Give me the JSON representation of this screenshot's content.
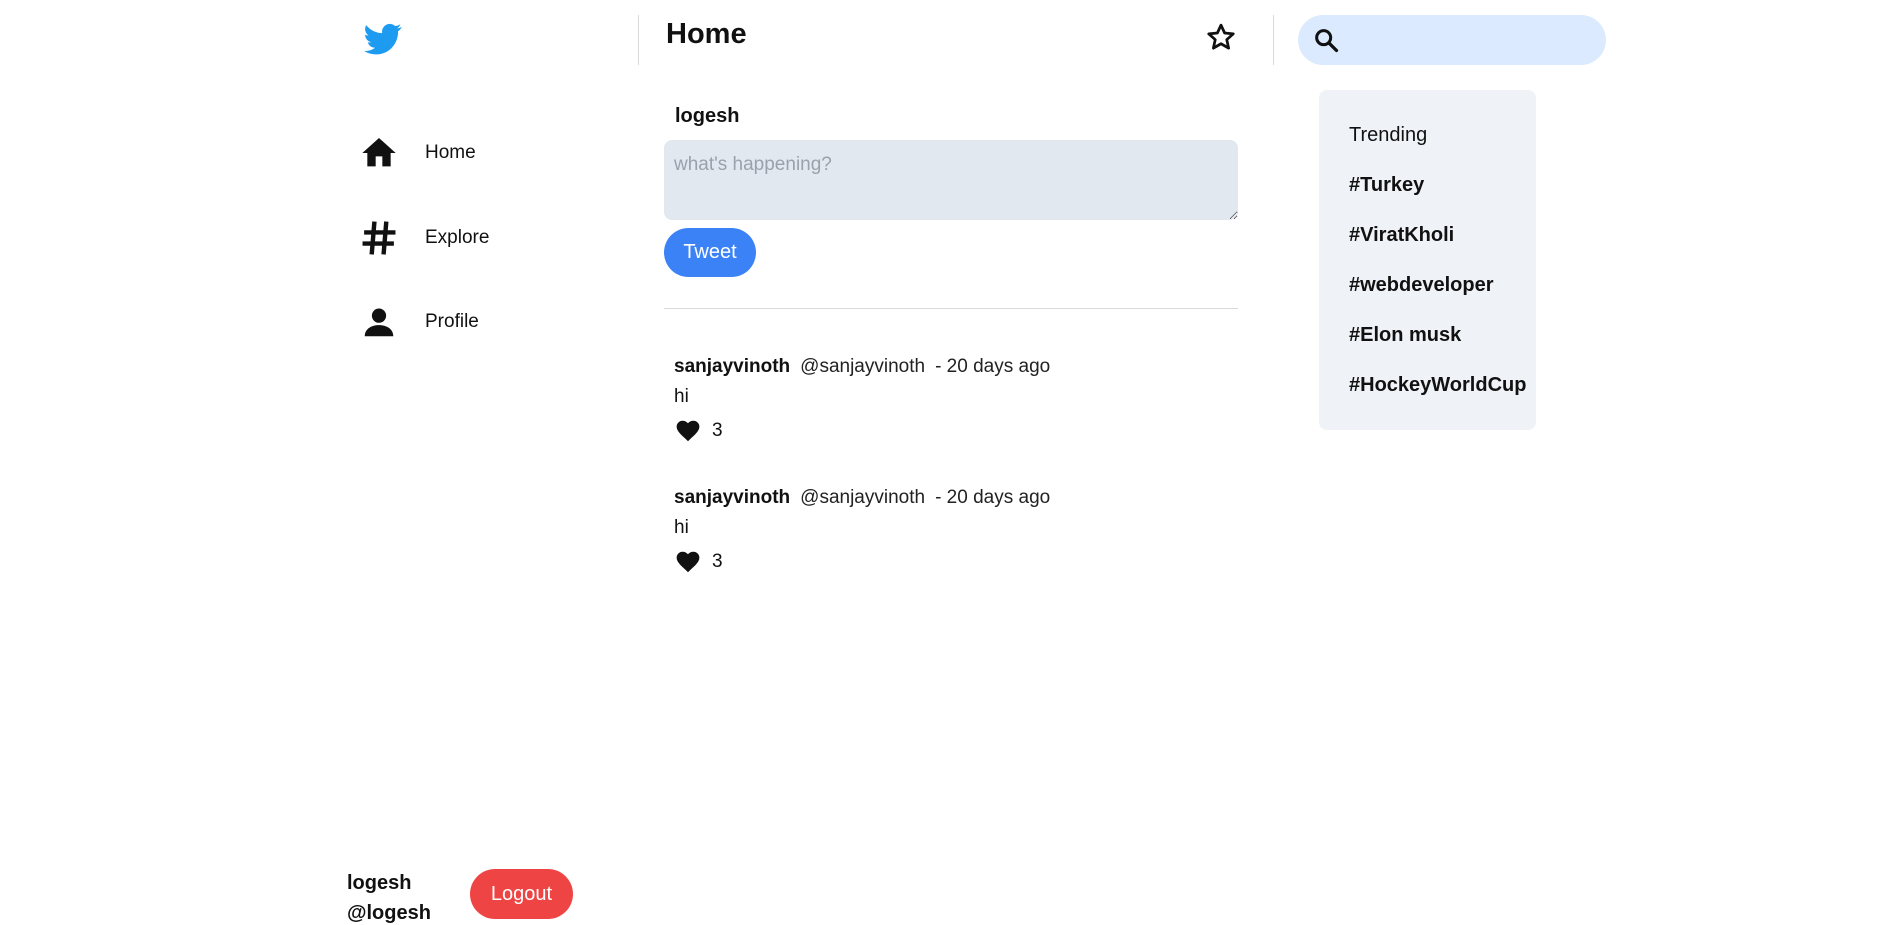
{
  "app": {
    "logo_icon": "twitter-bird-icon",
    "brand_color": "#1d9bf0"
  },
  "sidebar": {
    "items": [
      {
        "label": "Home",
        "icon": "home-icon"
      },
      {
        "label": "Explore",
        "icon": "hashtag-icon"
      },
      {
        "label": "Profile",
        "icon": "person-icon"
      }
    ],
    "user": {
      "name": "logesh",
      "handle": "@logesh"
    },
    "logout_label": "Logout"
  },
  "header": {
    "title": "Home",
    "star_icon": "star-icon"
  },
  "composer": {
    "username": "logesh",
    "placeholder": "what's happening?",
    "value": "",
    "tweet_label": "Tweet"
  },
  "feed": [
    {
      "author": "sanjayvinoth",
      "handle": "@sanjayvinoth",
      "time": "- 20 days ago",
      "text": "hi",
      "likes": "3"
    },
    {
      "author": "sanjayvinoth",
      "handle": "@sanjayvinoth",
      "time": "- 20 days ago",
      "text": "hi",
      "likes": "3"
    }
  ],
  "search": {
    "placeholder": "",
    "value": ""
  },
  "trending": {
    "title": "Trending",
    "items": [
      "#Turkey",
      "#ViratKholi",
      "#webdeveloper",
      "#Elon musk",
      "#HockeyWorldCup"
    ]
  },
  "colors": {
    "tweet_button": "#3b82f6",
    "logout_button": "#ef4444",
    "search_bg": "#dbeafe",
    "composer_bg": "#e2e8f0",
    "trending_bg": "#eff2f7"
  }
}
